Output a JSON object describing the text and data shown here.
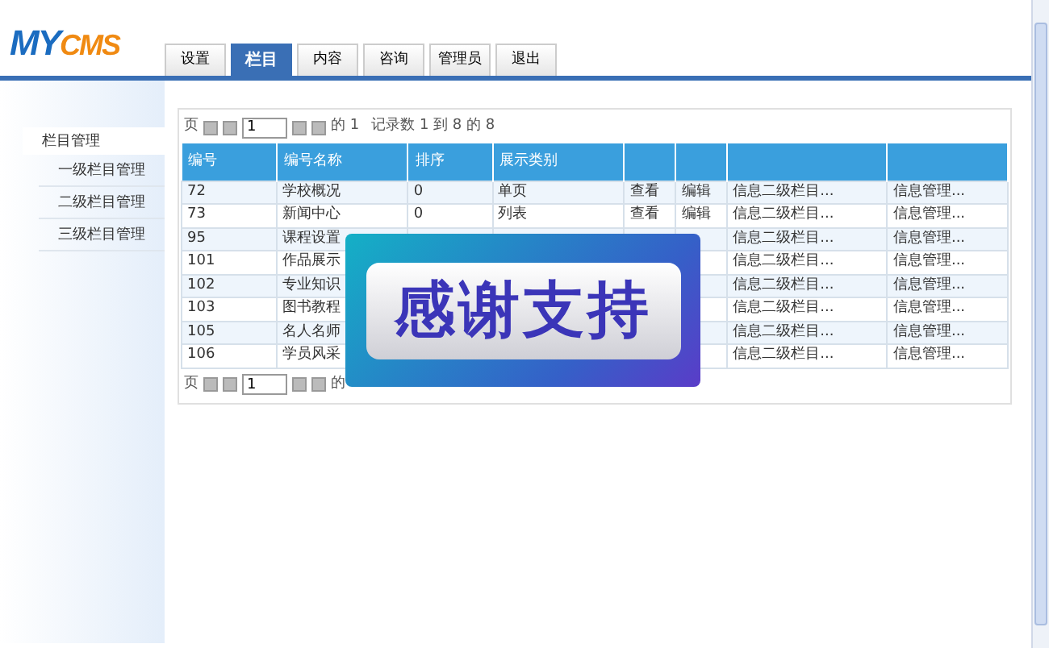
{
  "logo": {
    "part_1": "MY",
    "part_2": "CMS"
  },
  "tabs": [
    {
      "label": "设置",
      "selected": false
    },
    {
      "label": "栏目",
      "selected": true
    },
    {
      "label": "内容",
      "selected": false
    },
    {
      "label": "咨询",
      "selected": false
    },
    {
      "label": "管理员",
      "selected": false
    },
    {
      "label": "退出",
      "selected": false
    }
  ],
  "sidebar": {
    "title": "栏目管理",
    "items": [
      {
        "label": "一级栏目管理"
      },
      {
        "label": "二级栏目管理"
      },
      {
        "label": "三级栏目管理"
      }
    ]
  },
  "pager_top": {
    "page_label": "页",
    "page": "1",
    "of_text": "的 1",
    "records": "记录数 1 到 8 的 8"
  },
  "table": {
    "columns": [
      "编号",
      "编号名称",
      "排序",
      "展示类别"
    ],
    "rows": [
      {
        "id": "72",
        "name": "学校概况",
        "sort": "0",
        "display": "单页",
        "view": "查看",
        "edit": "编辑",
        "column_7": "信息二级栏目...",
        "column_8": "信息管理..."
      },
      {
        "id": "73",
        "name": "新闻中心",
        "sort": "0",
        "display": "列表",
        "view": "查看",
        "edit": "编辑",
        "column_7": "信息二级栏目...",
        "column_8": "信息管理..."
      },
      {
        "id": "95",
        "name": "课程设置",
        "column_7": "信息二级栏目...",
        "column_8": "信息管理..."
      },
      {
        "id": "101",
        "name": "作品展示",
        "column_7": "信息二级栏目...",
        "column_8": "信息管理..."
      },
      {
        "id": "102",
        "name": "专业知识",
        "column_7": "信息二级栏目...",
        "column_8": "信息管理..."
      },
      {
        "id": "103",
        "name": "图书教程",
        "column_7": "信息二级栏目...",
        "column_8": "信息管理..."
      },
      {
        "id": "105",
        "name": "名人名师",
        "column_7": "信息二级栏目...",
        "column_8": "信息管理..."
      },
      {
        "id": "106",
        "name": "学员风采",
        "column_7": "信息二级栏目...",
        "column_8": "信息管理..."
      }
    ]
  },
  "pager_bottom": {
    "page_label": "页",
    "page": "1",
    "of_text": "的"
  },
  "overlay": {
    "text": "感谢支持"
  }
}
